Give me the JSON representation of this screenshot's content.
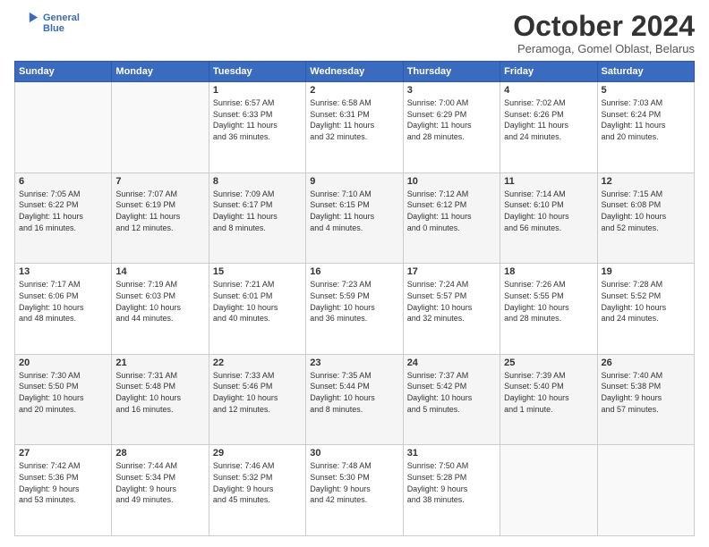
{
  "header": {
    "logo_line1": "General",
    "logo_line2": "Blue",
    "month_title": "October 2024",
    "location": "Peramoga, Gomel Oblast, Belarus"
  },
  "weekdays": [
    "Sunday",
    "Monday",
    "Tuesday",
    "Wednesday",
    "Thursday",
    "Friday",
    "Saturday"
  ],
  "weeks": [
    [
      {
        "day": "",
        "content": ""
      },
      {
        "day": "",
        "content": ""
      },
      {
        "day": "1",
        "content": "Sunrise: 6:57 AM\nSunset: 6:33 PM\nDaylight: 11 hours\nand 36 minutes."
      },
      {
        "day": "2",
        "content": "Sunrise: 6:58 AM\nSunset: 6:31 PM\nDaylight: 11 hours\nand 32 minutes."
      },
      {
        "day": "3",
        "content": "Sunrise: 7:00 AM\nSunset: 6:29 PM\nDaylight: 11 hours\nand 28 minutes."
      },
      {
        "day": "4",
        "content": "Sunrise: 7:02 AM\nSunset: 6:26 PM\nDaylight: 11 hours\nand 24 minutes."
      },
      {
        "day": "5",
        "content": "Sunrise: 7:03 AM\nSunset: 6:24 PM\nDaylight: 11 hours\nand 20 minutes."
      }
    ],
    [
      {
        "day": "6",
        "content": "Sunrise: 7:05 AM\nSunset: 6:22 PM\nDaylight: 11 hours\nand 16 minutes."
      },
      {
        "day": "7",
        "content": "Sunrise: 7:07 AM\nSunset: 6:19 PM\nDaylight: 11 hours\nand 12 minutes."
      },
      {
        "day": "8",
        "content": "Sunrise: 7:09 AM\nSunset: 6:17 PM\nDaylight: 11 hours\nand 8 minutes."
      },
      {
        "day": "9",
        "content": "Sunrise: 7:10 AM\nSunset: 6:15 PM\nDaylight: 11 hours\nand 4 minutes."
      },
      {
        "day": "10",
        "content": "Sunrise: 7:12 AM\nSunset: 6:12 PM\nDaylight: 11 hours\nand 0 minutes."
      },
      {
        "day": "11",
        "content": "Sunrise: 7:14 AM\nSunset: 6:10 PM\nDaylight: 10 hours\nand 56 minutes."
      },
      {
        "day": "12",
        "content": "Sunrise: 7:15 AM\nSunset: 6:08 PM\nDaylight: 10 hours\nand 52 minutes."
      }
    ],
    [
      {
        "day": "13",
        "content": "Sunrise: 7:17 AM\nSunset: 6:06 PM\nDaylight: 10 hours\nand 48 minutes."
      },
      {
        "day": "14",
        "content": "Sunrise: 7:19 AM\nSunset: 6:03 PM\nDaylight: 10 hours\nand 44 minutes."
      },
      {
        "day": "15",
        "content": "Sunrise: 7:21 AM\nSunset: 6:01 PM\nDaylight: 10 hours\nand 40 minutes."
      },
      {
        "day": "16",
        "content": "Sunrise: 7:23 AM\nSunset: 5:59 PM\nDaylight: 10 hours\nand 36 minutes."
      },
      {
        "day": "17",
        "content": "Sunrise: 7:24 AM\nSunset: 5:57 PM\nDaylight: 10 hours\nand 32 minutes."
      },
      {
        "day": "18",
        "content": "Sunrise: 7:26 AM\nSunset: 5:55 PM\nDaylight: 10 hours\nand 28 minutes."
      },
      {
        "day": "19",
        "content": "Sunrise: 7:28 AM\nSunset: 5:52 PM\nDaylight: 10 hours\nand 24 minutes."
      }
    ],
    [
      {
        "day": "20",
        "content": "Sunrise: 7:30 AM\nSunset: 5:50 PM\nDaylight: 10 hours\nand 20 minutes."
      },
      {
        "day": "21",
        "content": "Sunrise: 7:31 AM\nSunset: 5:48 PM\nDaylight: 10 hours\nand 16 minutes."
      },
      {
        "day": "22",
        "content": "Sunrise: 7:33 AM\nSunset: 5:46 PM\nDaylight: 10 hours\nand 12 minutes."
      },
      {
        "day": "23",
        "content": "Sunrise: 7:35 AM\nSunset: 5:44 PM\nDaylight: 10 hours\nand 8 minutes."
      },
      {
        "day": "24",
        "content": "Sunrise: 7:37 AM\nSunset: 5:42 PM\nDaylight: 10 hours\nand 5 minutes."
      },
      {
        "day": "25",
        "content": "Sunrise: 7:39 AM\nSunset: 5:40 PM\nDaylight: 10 hours\nand 1 minute."
      },
      {
        "day": "26",
        "content": "Sunrise: 7:40 AM\nSunset: 5:38 PM\nDaylight: 9 hours\nand 57 minutes."
      }
    ],
    [
      {
        "day": "27",
        "content": "Sunrise: 7:42 AM\nSunset: 5:36 PM\nDaylight: 9 hours\nand 53 minutes."
      },
      {
        "day": "28",
        "content": "Sunrise: 7:44 AM\nSunset: 5:34 PM\nDaylight: 9 hours\nand 49 minutes."
      },
      {
        "day": "29",
        "content": "Sunrise: 7:46 AM\nSunset: 5:32 PM\nDaylight: 9 hours\nand 45 minutes."
      },
      {
        "day": "30",
        "content": "Sunrise: 7:48 AM\nSunset: 5:30 PM\nDaylight: 9 hours\nand 42 minutes."
      },
      {
        "day": "31",
        "content": "Sunrise: 7:50 AM\nSunset: 5:28 PM\nDaylight: 9 hours\nand 38 minutes."
      },
      {
        "day": "",
        "content": ""
      },
      {
        "day": "",
        "content": ""
      }
    ]
  ]
}
